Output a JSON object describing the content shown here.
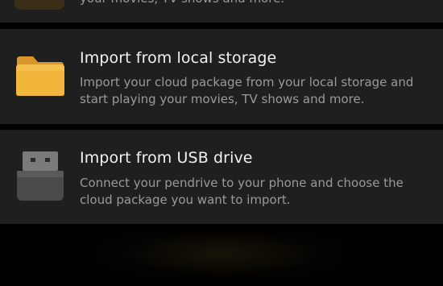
{
  "cards": [
    {
      "icon": "cloud-icon",
      "desc_tail": "your movies, TV shows and more."
    },
    {
      "icon": "folder-icon",
      "title": "Import from local storage",
      "description": "Import your cloud package from your local storage and start playing your movies, TV shows and more."
    },
    {
      "icon": "usb-drive-icon",
      "title": "Import from USB drive",
      "description": "Connect your pendrive to your phone and choose the cloud package you want to import."
    }
  ],
  "colors": {
    "card_background": "#1f1f1f",
    "title": "#f2f2f2",
    "description": "#9a9a9a",
    "folder": "#f2b63d"
  }
}
